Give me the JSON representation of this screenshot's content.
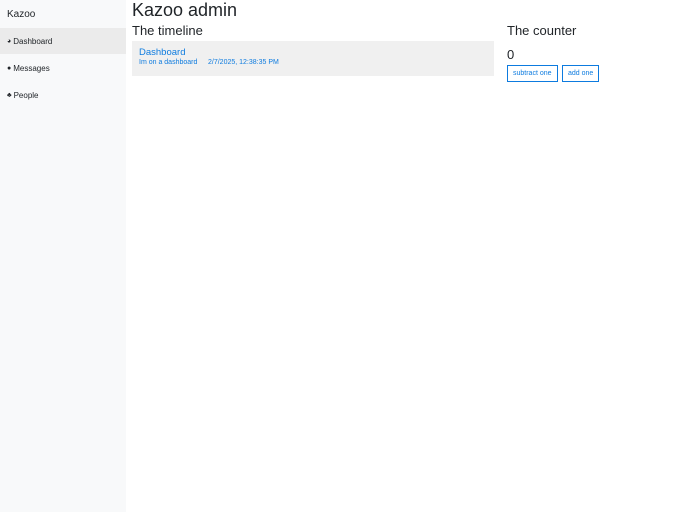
{
  "sidebar": {
    "brand": "Kazoo",
    "items": [
      {
        "label": "Dashboard",
        "icon": "dashboard-icon"
      },
      {
        "label": "Messages",
        "icon": "comments-icon"
      },
      {
        "label": "People",
        "icon": "users-icon"
      }
    ]
  },
  "main": {
    "title": "Kazoo admin",
    "timeline": {
      "heading": "The timeline",
      "entry": {
        "title": "Dashboard",
        "text": "Im on a dashboard",
        "timestamp": "2/7/2025, 12:38:35 PM"
      }
    },
    "counter": {
      "heading": "The counter",
      "value": "0",
      "subtract_label": "subtract one",
      "add_label": "add one"
    }
  },
  "colors": {
    "accent": "#0d7bdf",
    "sidebar_bg": "#f8f9fa"
  }
}
